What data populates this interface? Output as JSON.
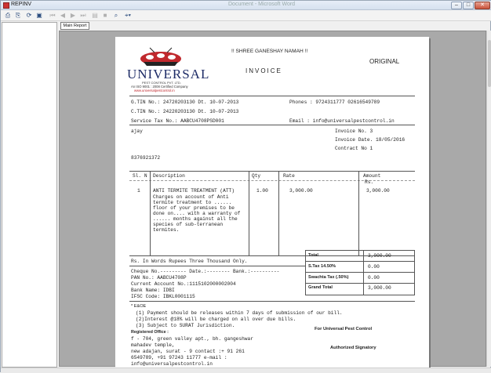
{
  "window": {
    "title": "REPINV",
    "ghost_title": "Document - Microsoft Word",
    "minimize_icon": "minimize-icon",
    "maximize_icon": "maximize-icon",
    "close_icon": "close-icon"
  },
  "toolbar": {
    "icons": [
      "print-icon",
      "print-setup-icon",
      "refresh-icon",
      "export-icon",
      "first-page-icon",
      "previous-page-icon",
      "next-page-icon",
      "last-page-icon",
      "go-to-page-icon",
      "stop-icon",
      "search-icon",
      "zoom-icon"
    ]
  },
  "report_tab": "Main Report",
  "invoice": {
    "blessing": "!! SHREE GANESHAY NAMAH !!",
    "copy_label": "ORIGINAL",
    "doc_title": "INVOICE",
    "company": {
      "name": "UNIVERSAL",
      "subtitle": "PEST CONTROL PVT. LTD.",
      "certification": "An ISO 9001 : 2008 Certified Company",
      "website": "www.universalpestcontrol.in",
      "brand_color": "#c0282d"
    },
    "gtin": "G.TIN No.: 24720203130 Dt.   10-07-2013",
    "ctin": "C.TIN No.: 24220203130 Dt.   10-07-2013",
    "service_tax": "Service Tax No.: AABCU4708PSD001",
    "phones": "Phones : 9724311777 02616549789",
    "email": "Email : info@universalpestcontrol.in",
    "customer_name": "ajay",
    "customer_phone": "8376921372",
    "invoice_no": "Invoice No.   3",
    "invoice_date": "Invoice Date. 18/05/2016",
    "contract_no": "Contract  No   1",
    "table": {
      "headers": [
        "Sl. N",
        "Description",
        "Qty",
        "Rate",
        "Amount"
      ],
      "amount_sub": "Rs.",
      "row": {
        "sl": "1",
        "description": [
          "ANTI TERMITE TREATMENT (ATT)",
          "Charges on account of Anti",
          "termite treatment to ......",
          "floor of your premises to be",
          "done on.... with a warranty of",
          "...... months against all the",
          "species of sub-terranean",
          "termites."
        ],
        "qty": "1.00",
        "rate": "3,000.00",
        "amount": "3,000.00"
      }
    },
    "in_words": "Rs. In Words Rupees Three Thousand Only.",
    "totals": [
      {
        "label": "Total",
        "value": "3,000.00"
      },
      {
        "label": "S.Tax 14.50%",
        "value": "0.00"
      },
      {
        "label": "Swachta Tax (.50%)",
        "value": "0.00"
      },
      {
        "label": "Grand Total",
        "value": "3,000.00"
      }
    ],
    "cheque_line": "Cheque No.---------  Date.:--------  Bank.:----------",
    "pan": "PAN No.:          AABCU4708P",
    "account": "Current Account No.:1115102000002004",
    "bank": "Bank Name:         IDBI",
    "ifsc": "IFSC Code:         IBKL0001115",
    "eoe": "* E&OE",
    "terms": [
      "(1) Payment should be releases within 7 days of submission of our bill.",
      "(2)Interest @18% will be charged on all over due bills.",
      "(3) Subject to SURAT Jurisdiction."
    ],
    "for_company": "For   Universal Pest Control",
    "registered_office_label": "Registered Office :",
    "address": [
      "f - 704, green valley apt., bh. gangeshwar",
      "mahadev temple,",
      "new adajan, surat - 9 contact :+ 91 261",
      "6549789, +91 97243 11777 e-mail :",
      "info@universalpestcontrol.in"
    ],
    "signatory": "Authorized Signatory"
  }
}
